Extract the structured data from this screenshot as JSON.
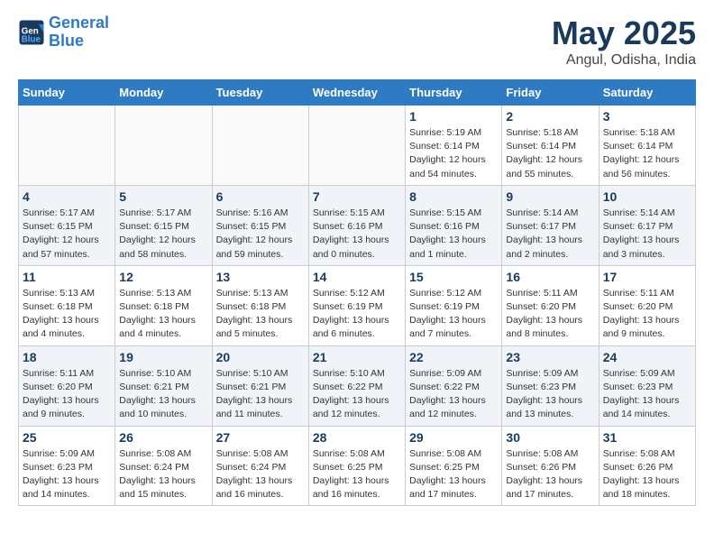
{
  "logo": {
    "line1": "General",
    "line2": "Blue"
  },
  "title": "May 2025",
  "location": "Angul, Odisha, India",
  "days_of_week": [
    "Sunday",
    "Monday",
    "Tuesday",
    "Wednesday",
    "Thursday",
    "Friday",
    "Saturday"
  ],
  "weeks": [
    [
      {
        "day": "",
        "info": ""
      },
      {
        "day": "",
        "info": ""
      },
      {
        "day": "",
        "info": ""
      },
      {
        "day": "",
        "info": ""
      },
      {
        "day": "1",
        "info": "Sunrise: 5:19 AM\nSunset: 6:14 PM\nDaylight: 12 hours\nand 54 minutes."
      },
      {
        "day": "2",
        "info": "Sunrise: 5:18 AM\nSunset: 6:14 PM\nDaylight: 12 hours\nand 55 minutes."
      },
      {
        "day": "3",
        "info": "Sunrise: 5:18 AM\nSunset: 6:14 PM\nDaylight: 12 hours\nand 56 minutes."
      }
    ],
    [
      {
        "day": "4",
        "info": "Sunrise: 5:17 AM\nSunset: 6:15 PM\nDaylight: 12 hours\nand 57 minutes."
      },
      {
        "day": "5",
        "info": "Sunrise: 5:17 AM\nSunset: 6:15 PM\nDaylight: 12 hours\nand 58 minutes."
      },
      {
        "day": "6",
        "info": "Sunrise: 5:16 AM\nSunset: 6:15 PM\nDaylight: 12 hours\nand 59 minutes."
      },
      {
        "day": "7",
        "info": "Sunrise: 5:15 AM\nSunset: 6:16 PM\nDaylight: 13 hours\nand 0 minutes."
      },
      {
        "day": "8",
        "info": "Sunrise: 5:15 AM\nSunset: 6:16 PM\nDaylight: 13 hours\nand 1 minute."
      },
      {
        "day": "9",
        "info": "Sunrise: 5:14 AM\nSunset: 6:17 PM\nDaylight: 13 hours\nand 2 minutes."
      },
      {
        "day": "10",
        "info": "Sunrise: 5:14 AM\nSunset: 6:17 PM\nDaylight: 13 hours\nand 3 minutes."
      }
    ],
    [
      {
        "day": "11",
        "info": "Sunrise: 5:13 AM\nSunset: 6:18 PM\nDaylight: 13 hours\nand 4 minutes."
      },
      {
        "day": "12",
        "info": "Sunrise: 5:13 AM\nSunset: 6:18 PM\nDaylight: 13 hours\nand 4 minutes."
      },
      {
        "day": "13",
        "info": "Sunrise: 5:13 AM\nSunset: 6:18 PM\nDaylight: 13 hours\nand 5 minutes."
      },
      {
        "day": "14",
        "info": "Sunrise: 5:12 AM\nSunset: 6:19 PM\nDaylight: 13 hours\nand 6 minutes."
      },
      {
        "day": "15",
        "info": "Sunrise: 5:12 AM\nSunset: 6:19 PM\nDaylight: 13 hours\nand 7 minutes."
      },
      {
        "day": "16",
        "info": "Sunrise: 5:11 AM\nSunset: 6:20 PM\nDaylight: 13 hours\nand 8 minutes."
      },
      {
        "day": "17",
        "info": "Sunrise: 5:11 AM\nSunset: 6:20 PM\nDaylight: 13 hours\nand 9 minutes."
      }
    ],
    [
      {
        "day": "18",
        "info": "Sunrise: 5:11 AM\nSunset: 6:20 PM\nDaylight: 13 hours\nand 9 minutes."
      },
      {
        "day": "19",
        "info": "Sunrise: 5:10 AM\nSunset: 6:21 PM\nDaylight: 13 hours\nand 10 minutes."
      },
      {
        "day": "20",
        "info": "Sunrise: 5:10 AM\nSunset: 6:21 PM\nDaylight: 13 hours\nand 11 minutes."
      },
      {
        "day": "21",
        "info": "Sunrise: 5:10 AM\nSunset: 6:22 PM\nDaylight: 13 hours\nand 12 minutes."
      },
      {
        "day": "22",
        "info": "Sunrise: 5:09 AM\nSunset: 6:22 PM\nDaylight: 13 hours\nand 12 minutes."
      },
      {
        "day": "23",
        "info": "Sunrise: 5:09 AM\nSunset: 6:23 PM\nDaylight: 13 hours\nand 13 minutes."
      },
      {
        "day": "24",
        "info": "Sunrise: 5:09 AM\nSunset: 6:23 PM\nDaylight: 13 hours\nand 14 minutes."
      }
    ],
    [
      {
        "day": "25",
        "info": "Sunrise: 5:09 AM\nSunset: 6:23 PM\nDaylight: 13 hours\nand 14 minutes."
      },
      {
        "day": "26",
        "info": "Sunrise: 5:08 AM\nSunset: 6:24 PM\nDaylight: 13 hours\nand 15 minutes."
      },
      {
        "day": "27",
        "info": "Sunrise: 5:08 AM\nSunset: 6:24 PM\nDaylight: 13 hours\nand 16 minutes."
      },
      {
        "day": "28",
        "info": "Sunrise: 5:08 AM\nSunset: 6:25 PM\nDaylight: 13 hours\nand 16 minutes."
      },
      {
        "day": "29",
        "info": "Sunrise: 5:08 AM\nSunset: 6:25 PM\nDaylight: 13 hours\nand 17 minutes."
      },
      {
        "day": "30",
        "info": "Sunrise: 5:08 AM\nSunset: 6:26 PM\nDaylight: 13 hours\nand 17 minutes."
      },
      {
        "day": "31",
        "info": "Sunrise: 5:08 AM\nSunset: 6:26 PM\nDaylight: 13 hours\nand 18 minutes."
      }
    ]
  ]
}
